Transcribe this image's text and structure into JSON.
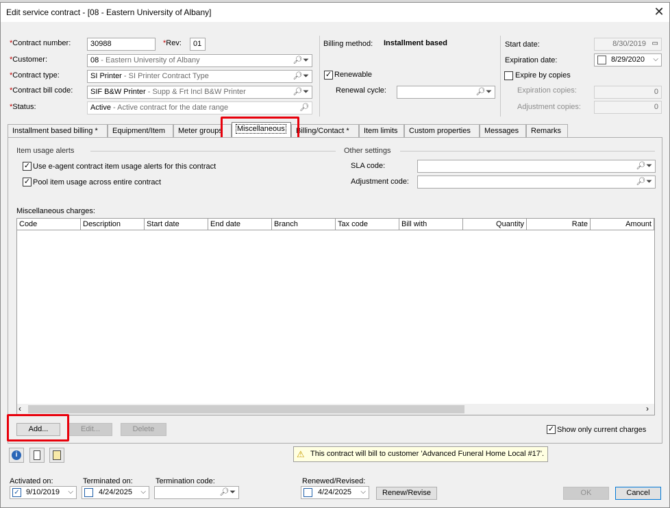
{
  "window": {
    "title": "Edit service contract - [08 - Eastern University of Albany]",
    "close_glyph": "✕"
  },
  "header": {
    "contract_number_label": "Contract number:",
    "contract_number": "30988",
    "rev_label": "Rev:",
    "rev": "01",
    "customer_label": "Customer:",
    "customer_code": "08",
    "customer_desc": " - Eastern University of Albany",
    "contract_type_label": "Contract type:",
    "contract_type_code": "SI Printer",
    "contract_type_desc": " - SI Printer Contract Type",
    "bill_code_label": "Contract bill code:",
    "bill_code": "SIF B&W Printer",
    "bill_code_desc": " - Supp & Frt Incl B&W Printer",
    "status_label": "Status:",
    "status": "Active",
    "status_desc": " - Active contract for the date range",
    "required_mark": "*",
    "billing_method_label": "Billing method:",
    "billing_method": "Installment based",
    "renewable_label": "Renewable",
    "renewable_checked": true,
    "renewal_cycle_label": "Renewal cycle:",
    "renewal_cycle": "",
    "start_date_label": "Start date:",
    "start_date": "8/30/2019",
    "expiration_date_label": "Expiration date:",
    "expiration_date": "8/29/2020",
    "expire_by_copies_label": "Expire by copies",
    "expiration_copies_label": "Expiration copies:",
    "expiration_copies": "0",
    "adjustment_copies_label": "Adjustment copies:",
    "adjustment_copies": "0"
  },
  "tabs": [
    "Installment based billing *",
    "Equipment/Item",
    "Meter groups",
    "Miscellaneous",
    "Billing/Contact *",
    "Item limits",
    "Custom properties",
    "Messages",
    "Remarks"
  ],
  "active_tab": "Miscellaneous",
  "misc": {
    "item_usage_alerts_label": "Item usage alerts",
    "use_eagent_label": "Use e-agent contract item usage alerts for this contract",
    "use_eagent_checked": true,
    "pool_usage_label": "Pool item usage across entire contract",
    "pool_usage_checked": true,
    "other_settings_label": "Other settings",
    "sla_code_label": "SLA code:",
    "sla_code": "",
    "adjustment_code_label": "Adjustment code:",
    "adjustment_code": "",
    "charges_label": "Miscellaneous charges:",
    "columns": [
      "Code",
      "Description",
      "Start date",
      "End date",
      "Branch",
      "Tax code",
      "Bill with",
      "Quantity",
      "Rate",
      "Amount"
    ],
    "add_label": "Add...",
    "edit_label": "Edit...",
    "delete_label": "Delete",
    "show_current_label": "Show only current charges",
    "show_current_checked": true
  },
  "footer": {
    "info_icon": "info-icon",
    "warning_text": "This contract will bill to customer 'Advanced Funeral Home Local #17'.",
    "activated_on_label": "Activated on:",
    "activated_on": "9/10/2019",
    "terminated_on_label": "Terminated on:",
    "terminated_on": "4/24/2025",
    "termination_code_label": "Termination code:",
    "termination_code": "",
    "renewed_label": "Renewed/Revised:",
    "renewed_on": "4/24/2025",
    "renew_button": "Renew/Revise",
    "ok_button": "OK",
    "cancel_button": "Cancel"
  },
  "colors": {
    "highlight_red": "#e8000b",
    "required_red": "#c00000",
    "dialog_bg": "#f0f0f0",
    "accent_blue": "#0078d7"
  }
}
